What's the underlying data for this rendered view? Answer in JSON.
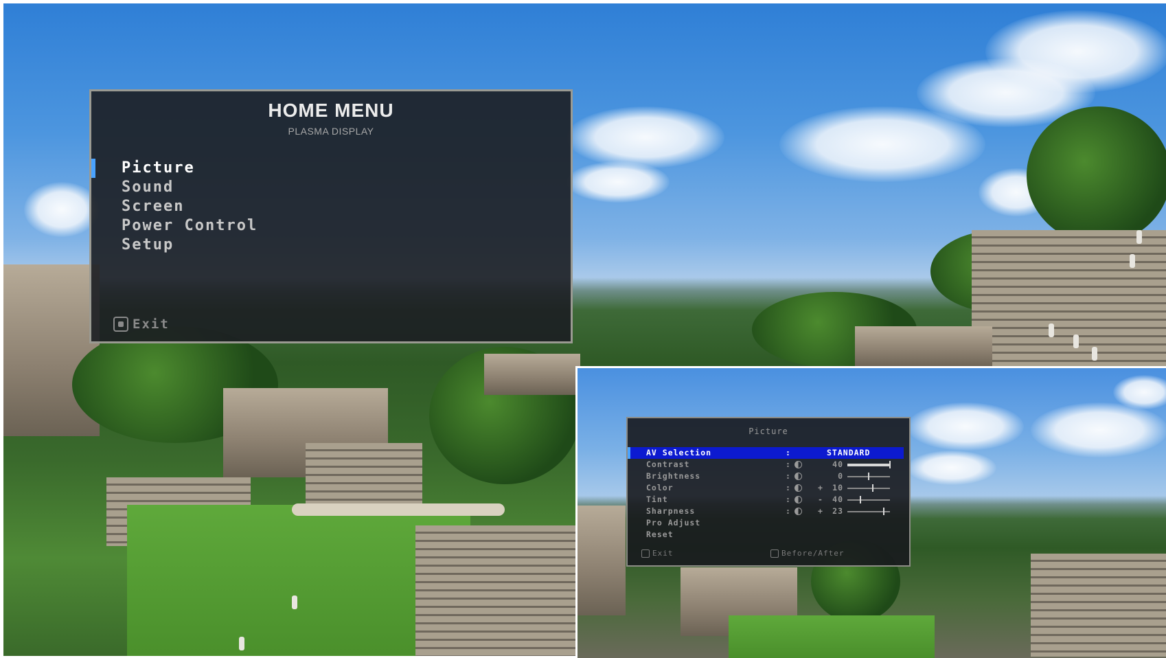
{
  "home_menu": {
    "title": "HOME MENU",
    "subtitle": "PLASMA DISPLAY",
    "items": [
      {
        "label": "Picture",
        "selected": true
      },
      {
        "label": "Sound",
        "selected": false
      },
      {
        "label": "Screen",
        "selected": false
      },
      {
        "label": "Power Control",
        "selected": false
      },
      {
        "label": "Setup",
        "selected": false
      }
    ],
    "exit_label": "Exit"
  },
  "picture_menu": {
    "title": "Picture",
    "av_selection": {
      "label": "AV Selection",
      "value": "STANDARD"
    },
    "settings": [
      {
        "label": "Contrast",
        "icon": "contrast-icon",
        "sign": "",
        "value": "40",
        "level": 1.0
      },
      {
        "label": "Brightness",
        "icon": "brightness-icon",
        "sign": "",
        "value": "0",
        "level": 0.5
      },
      {
        "label": "Color",
        "icon": "color-icon",
        "sign": "+",
        "value": "10",
        "level": 0.6
      },
      {
        "label": "Tint",
        "icon": "tint-icon",
        "sign": "-",
        "value": "40",
        "level": 0.3
      },
      {
        "label": "Sharpness",
        "icon": "sharpness-icon",
        "sign": "+",
        "value": "23",
        "level": 0.85
      }
    ],
    "extra_items": [
      "Pro Adjust",
      "Reset"
    ],
    "footer": {
      "exit_label": "Exit",
      "compare_label": "Before/After"
    }
  },
  "colors": {
    "highlight": "#0c1ad0",
    "highlight_edge": "#4aa3ff",
    "panel": "#1c1e22"
  }
}
